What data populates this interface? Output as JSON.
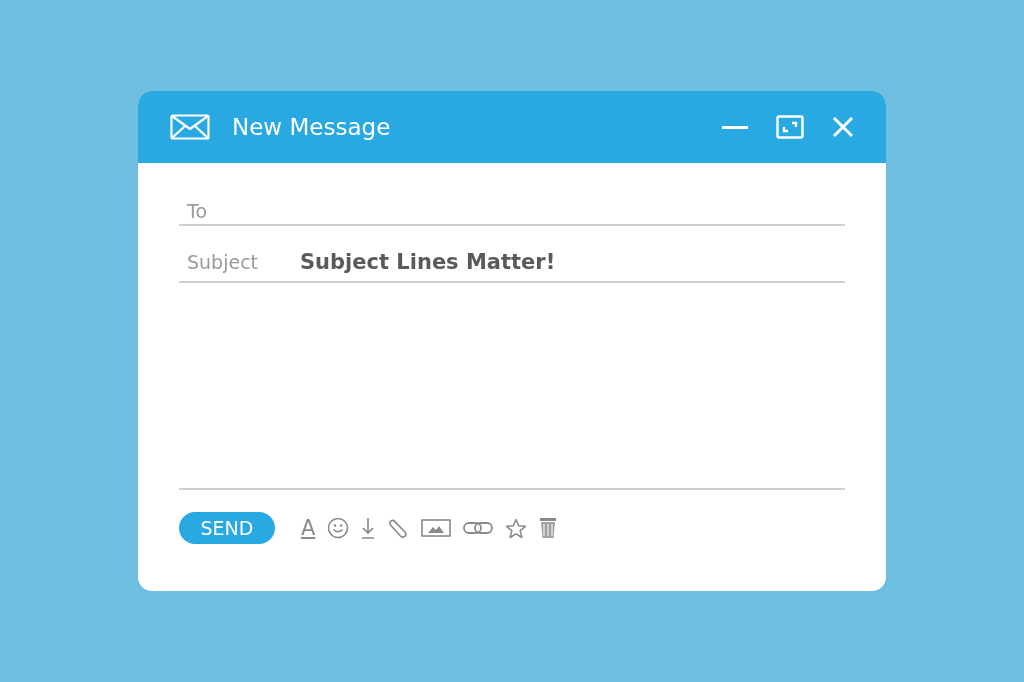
{
  "window": {
    "title": "New Message"
  },
  "fields": [
    {
      "label": "To"
    },
    {
      "label": "Subject",
      "value": "Subject Lines Matter!"
    }
  ],
  "toolbar": {
    "send": "SEND",
    "tools": [
      {
        "kind": "format",
        "glyph": "A"
      },
      {
        "kind": "emoji"
      },
      {
        "kind": "download"
      },
      {
        "kind": "attach"
      },
      {
        "kind": "image"
      },
      {
        "kind": "link"
      },
      {
        "kind": "star"
      },
      {
        "kind": "trash"
      }
    ]
  }
}
